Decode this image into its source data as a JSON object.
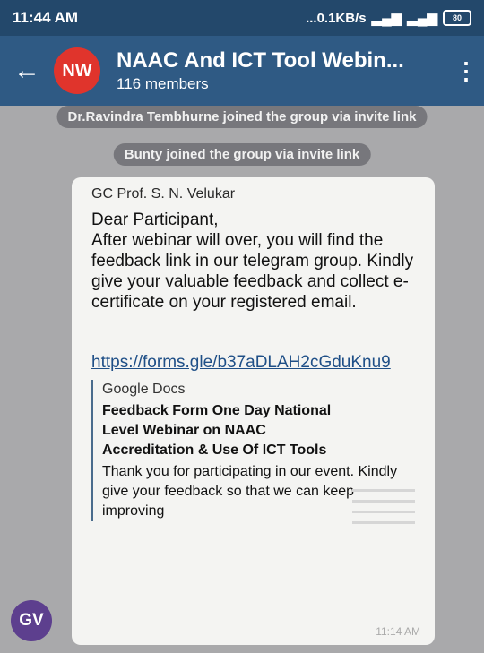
{
  "status": {
    "time": "11:44 AM",
    "network_speed": "...0.1KB/s",
    "battery": "80"
  },
  "header": {
    "avatar_initials": "NW",
    "title": "NAAC And ICT Tool Webin...",
    "subtitle": "116 members"
  },
  "system_messages": [
    "Dr.Ravindra Tembhurne joined the group via invite link",
    "Bunty joined the group via invite link"
  ],
  "message": {
    "sender": "GC Prof. S. N. Velukar",
    "text": "Dear Participant,\nAfter webinar will over, you will find the feedback link in our telegram group. Kindly give your valuable feedback and collect e-certificate on your registered email.",
    "link": "https://forms.gle/b37aDLAH2cGduKnu9",
    "preview_site": "Google Docs",
    "preview_title": "Feedback Form One Day National Level Webinar on NAAC Accreditation & Use Of ICT Tools",
    "preview_desc": "Thank you for participating in our event. Kindly give your feedback so that we can keep improving",
    "time": "11:14 AM",
    "sender_avatar": "GV"
  },
  "colors": {
    "toolbar": "#2f5a84",
    "status_bar": "#23486b",
    "avatar_nw": "#e0342c",
    "avatar_gv": "#5d3f8e"
  }
}
